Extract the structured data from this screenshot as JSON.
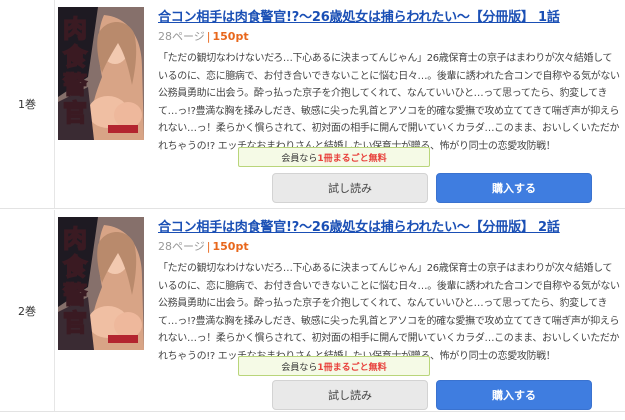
{
  "items": [
    {
      "volume": "1巻",
      "title": "合コン相手は肉食警官!?〜26歳処女は捕らわれたい〜【分冊版】 1話",
      "pages": "28ページ",
      "separator": "|",
      "price": "150pt",
      "description": "「ただの観切なわけないだろ…下心あるに決まってんじゃん」26歳保育士の京子はまわりが次々結婚しているのに、恋に臆病で、お付き合いできないことに悩む日々…。後輩に誘われた合コンで自称やる気がない公務員勇助に出会う。酔っ払った京子を介抱してくれて、なんていいひと…って思ってたら、豹変してきて…っ!?豊満な胸を揉みしだき、敏感に尖った乳首とアソコを的確な愛撫で攻め立ててきて喘ぎ声が抑えられない…っ！柔らかく慣らされて、初対面の相手に開んで開いていくカラダ…このまま、おいしくいただかれちゃうの!? エッチなおまわりさんと結婚したい保育士が贈る、怖がり同士の恋愛攻防戦！",
      "badge_prefix": "会員なら",
      "badge_highlight": "1冊まるごと無料",
      "trial_label": "試し読み",
      "buy_label": "購入する"
    },
    {
      "volume": "2巻",
      "title": "合コン相手は肉食警官!?〜26歳処女は捕らわれたい〜【分冊版】 2話",
      "pages": "28ページ",
      "separator": "|",
      "price": "150pt",
      "description": "「ただの観切なわけないだろ…下心あるに決まってんじゃん」26歳保育士の京子はまわりが次々結婚しているのに、恋に臆病で、お付き合いできないことに悩む日々…。後輩に誘われた合コンで自称やる気がない公務員勇助に出会う。酔っ払った京子を介抱してくれて、なんていいひと…って思ってたら、豹変してきて…っ!?豊満な胸を揉みしだき、敏感に尖った乳首とアソコを的確な愛撫で攻め立ててきて喘ぎ声が抑えられない…っ！柔らかく慣らされて、初対面の相手に開んで開いていくカラダ…このまま、おいしくいただかれちゃうの!? エッチなおまわりさんと結婚したい保育士が贈る、怖がり同士の恋愛攻防戦！",
      "badge_prefix": "会員なら",
      "badge_highlight": "1冊まるごと無料",
      "trial_label": "試し読み",
      "buy_label": "購入する"
    }
  ],
  "colors": {
    "title_link": "#1a4fb5",
    "price": "#e8671c",
    "badge_highlight": "#e8413c",
    "buy_button": "#3f7de0"
  }
}
